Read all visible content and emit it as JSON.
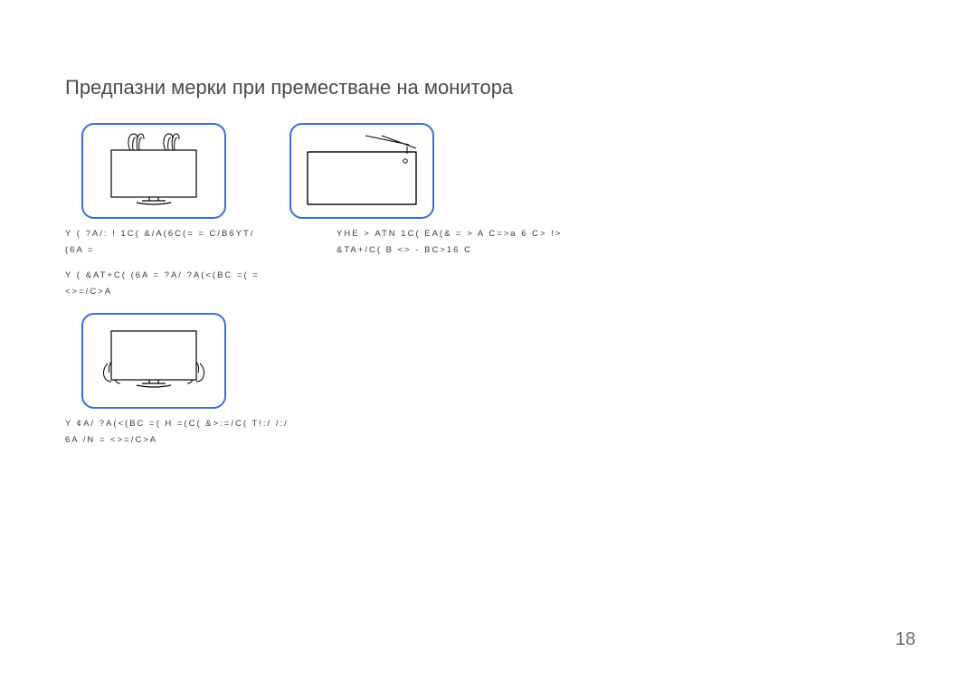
{
  "title": "Предпазни мерки при преместване на монитора",
  "figures": {
    "fig1_alt": "monitor-hold-top-corners",
    "fig2_alt": "monitor-flat-stand",
    "fig3_alt": "monitor-hold-bottom-corners"
  },
  "captions": {
    "left1_line1": "Y ( ?A/: ! 1C( &/A(6C(= = C/B6YT/",
    "left1_line2": "(6A =",
    "right1_line1": "YНЕ > ATN 1C( EA(&   = > A  C=>a 6 C> !>",
    "right1_line2": "&TA+/C( B <> -   BC>16 C",
    "left2_line1": "Y ( &AT+C( (6A = ?A/ ?A(<(BC   =( =",
    "left2_line2": "<>=/C>A",
    "bottom_line1": "Y ¢A/ ?A(<(BC   =( H =(C( &>:=/C( T!:/ /:/",
    "bottom_line2": "6A /N =   <>=/C>A"
  },
  "page_number": "18"
}
